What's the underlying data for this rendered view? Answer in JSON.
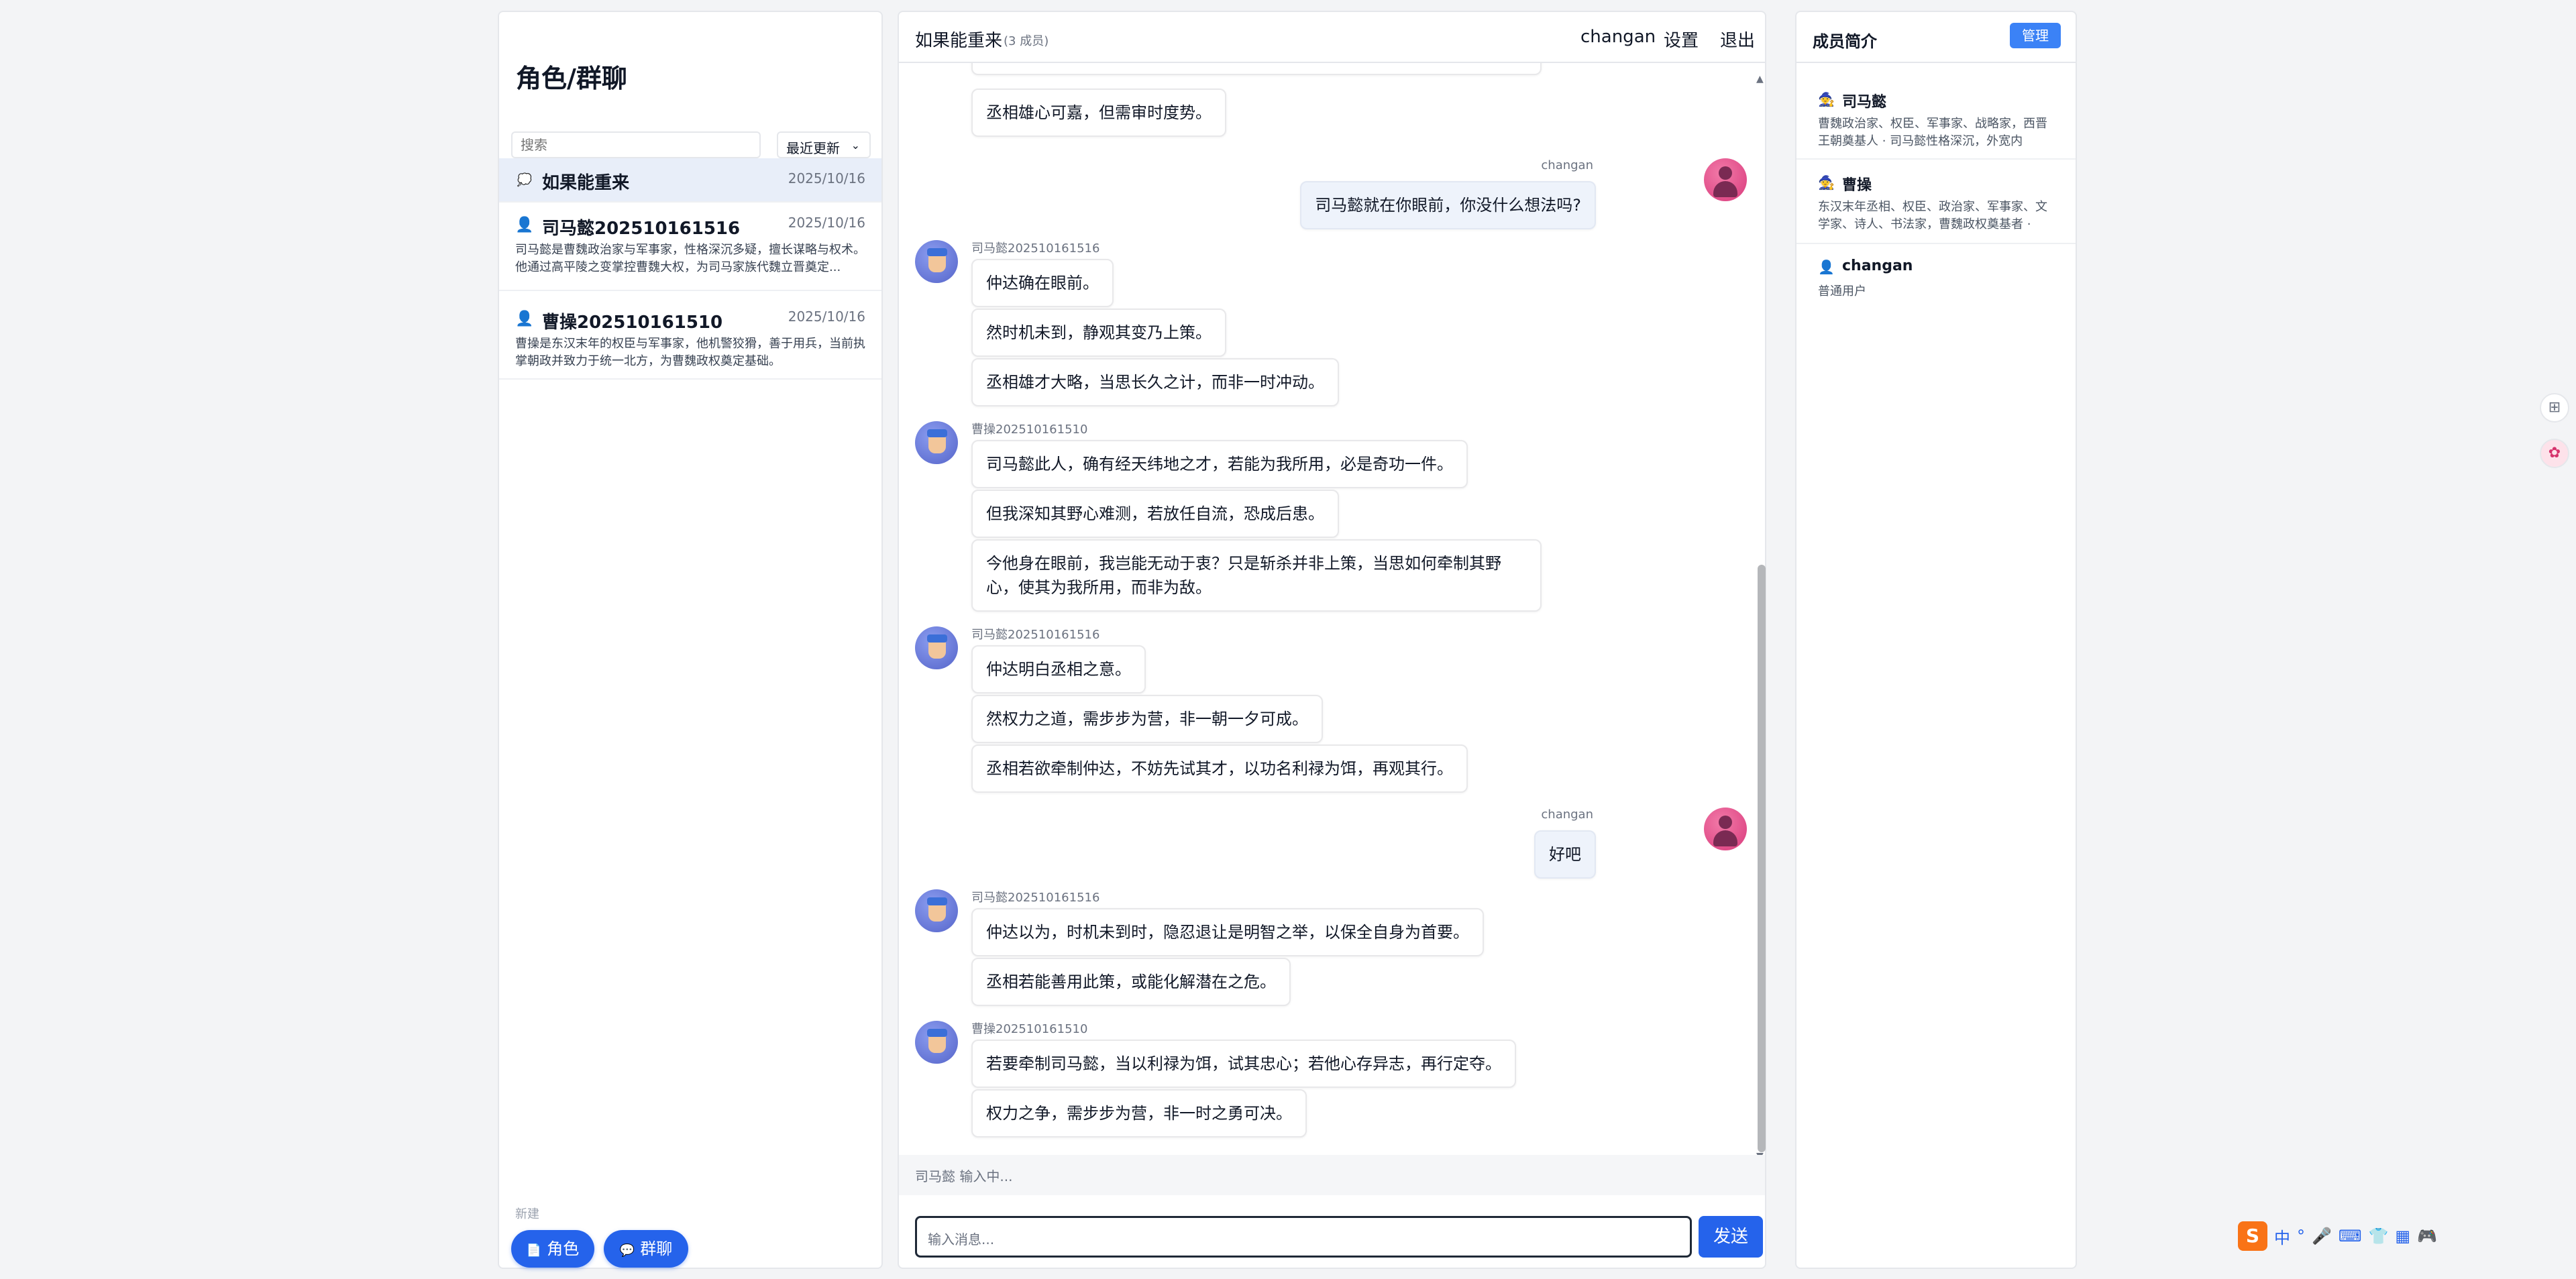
{
  "sidebar": {
    "title": "角色/群聊",
    "search_placeholder": "搜索",
    "sort_label": "最近更新",
    "conversations": [
      {
        "icon": "chat-bubble-icon",
        "name": "如果能重来",
        "date": "2025/10/16",
        "desc": ""
      },
      {
        "icon": "user-icon",
        "name": "司马懿202510161516",
        "date": "2025/10/16",
        "desc": "司马懿是曹魏政治家与军事家，性格深沉多疑，擅长谋略与权术。他通过高平陵之变掌控曹魏大权，为司马家族代魏立晋奠定..."
      },
      {
        "icon": "user-icon",
        "name": "曹操202510161510",
        "date": "2025/10/16",
        "desc": "曹操是东汉末年的权臣与军事家，他机警狡猾，善于用兵，当前执掌朝政并致力于统一北方，为曹魏政权奠定基础。"
      }
    ],
    "new_label": "新建",
    "new_role_label": "角色",
    "new_group_label": "群聊"
  },
  "chat": {
    "title": "如果能重来",
    "member_count": "(3 成员)",
    "user": "changan",
    "settings_label": "设置",
    "logout_label": "退出",
    "messages": [
      {
        "text": "丞相雄心可嘉，但需审时度势。"
      },
      {
        "sender": "changan",
        "text": "司马懿就在你眼前，你没什么想法吗?"
      },
      {
        "sender": "司马懿202510161516",
        "text": "仲达确在眼前。"
      },
      {
        "text": "然时机未到，静观其变乃上策。"
      },
      {
        "text": "丞相雄才大略，当思长久之计，而非一时冲动。"
      },
      {
        "sender": "曹操202510161510",
        "text": "司马懿此人，确有经天纬地之才，若能为我所用，必是奇功一件。"
      },
      {
        "text": "但我深知其野心难测，若放任自流，恐成后患。"
      },
      {
        "text": "今他身在眼前，我岂能无动于衷？只是斩杀并非上策，当思如何牵制其野心，使其为我所用，而非为敌。"
      },
      {
        "sender": "司马懿202510161516",
        "text": "仲达明白丞相之意。"
      },
      {
        "text": "然权力之道，需步步为营，非一朝一夕可成。"
      },
      {
        "text": "丞相若欲牵制仲达，不妨先试其才，以功名利禄为饵，再观其行。"
      },
      {
        "sender": "changan",
        "text": "好吧"
      },
      {
        "sender": "司马懿202510161516",
        "text": "仲达以为，时机未到时，隐忍退让是明智之举，以保全自身为首要。"
      },
      {
        "text": "丞相若能善用此策，或能化解潜在之危。"
      },
      {
        "sender": "曹操202510161510",
        "text": "若要牵制司马懿，当以利禄为饵，试其忠心；若他心存异志，再行定夺。"
      },
      {
        "text": "权力之争，需步步为营，非一时之勇可决。"
      }
    ],
    "typing": "司马懿 输入中...",
    "input_placeholder": "输入消息...",
    "send_label": "发送"
  },
  "members": {
    "title": "成员简介",
    "manage_label": "管理",
    "list": [
      {
        "name": "司马懿",
        "desc": "曹魏政治家、权臣、军事家、战略家，西晋王朝奠基人 · 司马懿性格深沉，外宽内忌，..."
      },
      {
        "name": "曹操",
        "desc": "东汉末年丞相、权臣、政治家、军事家、文学家、诗人、书法家，曹魏政权奠基者 · 任..."
      },
      {
        "name": "changan",
        "desc": "普通用户"
      }
    ]
  },
  "ime": {
    "lang": "中"
  },
  "colors": {
    "accent": "#2563eb",
    "bg": "#f3f4f6"
  }
}
